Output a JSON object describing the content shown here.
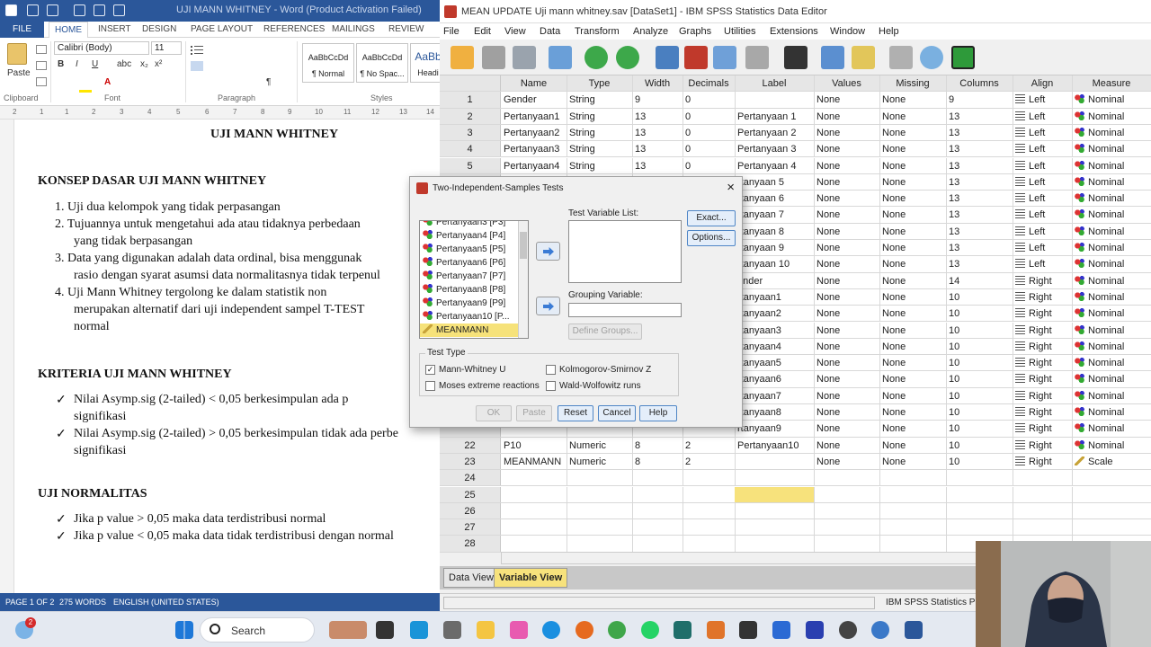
{
  "word": {
    "title": "UJI MANN WHITNEY - Word (Product Activation Failed)",
    "tabs": [
      "FILE",
      "HOME",
      "INSERT",
      "DESIGN",
      "PAGE LAYOUT",
      "REFERENCES",
      "MAILINGS",
      "REVIEW"
    ],
    "font_name": "Calibri (Body)",
    "font_size": "11",
    "paste_label": "Paste",
    "styles": [
      "AaBbCcDd",
      "AaBbCcDd",
      "AaBb"
    ],
    "style_names": [
      "¶ Normal",
      "¶ No Spac...",
      "Headi"
    ],
    "groups": [
      "Clipboard",
      "Font",
      "Paragraph",
      "Styles"
    ],
    "ruler_nums": [
      "1",
      "2",
      "1",
      "2",
      "3",
      "4",
      "5",
      "6",
      "7",
      "8",
      "9",
      "10",
      "11",
      "12",
      "13",
      "14"
    ],
    "doc": {
      "title": "UJI MANN WHITNEY",
      "h1": "KONSEP DASAR UJI MANN WHITNEY",
      "l1": "1.   Uji dua kelompok yang tidak perpasangan",
      "l2a": "2.   Tujuannya untuk mengetahui ada atau tidaknya perbedaan",
      "l2b": "yang tidak berpasangan",
      "l3a": "3.   Data yang digunakan adalah data ordinal, bisa menggunak",
      "l3b": "rasio dengan syarat asumsi data normalitasnya tidak terpenul",
      "l4a": "4.   Uji  Mann  Whitney  tergolong  ke  dalam  statistik  non",
      "l4b": "merupakan alternatif dari uji independent sampel T-TEST",
      "l4c": "normal",
      "h2": "KRITERIA UJI MANN WHITNEY",
      "k1a": "Nilai  Asymp.sig  (2-tailed)  <  0,05     berkesimpulan  ada  p",
      "k1b": "signifikasi",
      "k2a": "Nilai Asymp.sig (2-tailed) > 0,05   berkesimpulan tidak ada perbe",
      "k2b": "signifikasi",
      "h3": "UJI NORMALITAS",
      "n1": "Jika p value > 0,05 maka data terdistribusi normal",
      "n2": "Jika p value < 0,05 maka data tidak terdistribusi dengan normal",
      "check": "✓"
    },
    "status": {
      "page": "PAGE 1 OF 2",
      "words": "275 WORDS",
      "lang": "ENGLISH (UNITED STATES)"
    }
  },
  "spss": {
    "title": "MEAN UPDATE Uji mann whitney.sav [DataSet1] - IBM SPSS Statistics Data Editor",
    "menu": [
      "File",
      "Edit",
      "View",
      "Data",
      "Transform",
      "Analyze",
      "Graphs",
      "Utilities",
      "Extensions",
      "Window",
      "Help"
    ],
    "columns": [
      "Name",
      "Type",
      "Width",
      "Decimals",
      "Label",
      "Values",
      "Missing",
      "Columns",
      "Align",
      "Measure"
    ],
    "rows": [
      [
        "1",
        "Gender",
        "String",
        "9",
        "0",
        "",
        "None",
        "None",
        "9",
        "Left",
        "Nominal"
      ],
      [
        "2",
        "Pertanyaan1",
        "String",
        "13",
        "0",
        "Pertanyaan 1",
        "None",
        "None",
        "13",
        "Left",
        "Nominal"
      ],
      [
        "3",
        "Pertanyaan2",
        "String",
        "13",
        "0",
        "Pertanyaan 2",
        "None",
        "None",
        "13",
        "Left",
        "Nominal"
      ],
      [
        "4",
        "Pertanyaan3",
        "String",
        "13",
        "0",
        "Pertanyaan 3",
        "None",
        "None",
        "13",
        "Left",
        "Nominal"
      ],
      [
        "5",
        "Pertanyaan4",
        "String",
        "13",
        "0",
        "Pertanyaan 4",
        "None",
        "None",
        "13",
        "Left",
        "Nominal"
      ],
      [
        "",
        "",
        "",
        "",
        "",
        "rtanyaan 5",
        "None",
        "None",
        "13",
        "Left",
        "Nominal"
      ],
      [
        "",
        "",
        "",
        "",
        "",
        "rtanyaan 6",
        "None",
        "None",
        "13",
        "Left",
        "Nominal"
      ],
      [
        "",
        "",
        "",
        "",
        "",
        "rtanyaan 7",
        "None",
        "None",
        "13",
        "Left",
        "Nominal"
      ],
      [
        "",
        "",
        "",
        "",
        "",
        "rtanyaan 8",
        "None",
        "None",
        "13",
        "Left",
        "Nominal"
      ],
      [
        "",
        "",
        "",
        "",
        "",
        "rtanyaan 9",
        "None",
        "None",
        "13",
        "Left",
        "Nominal"
      ],
      [
        "",
        "",
        "",
        "",
        "",
        "rtanyaan 10",
        "None",
        "None",
        "13",
        "Left",
        "Nominal"
      ],
      [
        "",
        "",
        "",
        "",
        "",
        "ender",
        "None",
        "None",
        "14",
        "Right",
        "Nominal"
      ],
      [
        "",
        "",
        "",
        "",
        "",
        "rtanyaan1",
        "None",
        "None",
        "10",
        "Right",
        "Nominal"
      ],
      [
        "",
        "",
        "",
        "",
        "",
        "rtanyaan2",
        "None",
        "None",
        "10",
        "Right",
        "Nominal"
      ],
      [
        "",
        "",
        "",
        "",
        "",
        "rtanyaan3",
        "None",
        "None",
        "10",
        "Right",
        "Nominal"
      ],
      [
        "",
        "",
        "",
        "",
        "",
        "rtanyaan4",
        "None",
        "None",
        "10",
        "Right",
        "Nominal"
      ],
      [
        "",
        "",
        "",
        "",
        "",
        "rtanyaan5",
        "None",
        "None",
        "10",
        "Right",
        "Nominal"
      ],
      [
        "",
        "",
        "",
        "",
        "",
        "rtanyaan6",
        "None",
        "None",
        "10",
        "Right",
        "Nominal"
      ],
      [
        "",
        "",
        "",
        "",
        "",
        "rtanyaan7",
        "None",
        "None",
        "10",
        "Right",
        "Nominal"
      ],
      [
        "",
        "",
        "",
        "",
        "",
        "rtanyaan8",
        "None",
        "None",
        "10",
        "Right",
        "Nominal"
      ],
      [
        "",
        "",
        "",
        "",
        "",
        "rtanyaan9",
        "None",
        "None",
        "10",
        "Right",
        "Nominal"
      ],
      [
        "22",
        "P10",
        "Numeric",
        "8",
        "2",
        "Pertanyaan10",
        "None",
        "None",
        "10",
        "Right",
        "Nominal"
      ],
      [
        "23",
        "MEANMANN",
        "Numeric",
        "8",
        "2",
        "",
        "None",
        "None",
        "10",
        "Right",
        "Scale"
      ],
      [
        "24",
        "",
        "",
        "",
        "",
        "",
        "",
        "",
        "",
        "",
        ""
      ],
      [
        "25",
        "",
        "",
        "",
        "",
        "",
        "",
        "",
        "",
        "",
        ""
      ],
      [
        "26",
        "",
        "",
        "",
        "",
        "",
        "",
        "",
        "",
        "",
        ""
      ],
      [
        "27",
        "",
        "",
        "",
        "",
        "",
        "",
        "",
        "",
        "",
        ""
      ],
      [
        "28",
        "",
        "",
        "",
        "",
        "",
        "",
        "",
        "",
        "",
        ""
      ]
    ],
    "tab_data": "Data View",
    "tab_variable": "Variable View",
    "status_text": "IBM SPSS Statistics P"
  },
  "dialog": {
    "title": "Two-Independent-Samples Tests",
    "close": "×",
    "vars": [
      "Pertanyaan3 [P3]",
      "Pertanyaan4 [P4]",
      "Pertanyaan5 [P5]",
      "Pertanyaan6 [P6]",
      "Pertanyaan7 [P7]",
      "Pertanyaan8 [P8]",
      "Pertanyaan9 [P9]",
      "Pertanyaan10 [P...",
      "MEANMANN"
    ],
    "test_list_label": "Test Variable List:",
    "grouping_label": "Grouping Variable:",
    "define_groups": "Define Groups...",
    "exact": "Exact...",
    "options": "Options...",
    "test_type": "Test Type",
    "mann": "Mann-Whitney U",
    "ks": "Kolmogorov-Smirnov Z",
    "moses": "Moses extreme reactions",
    "ww": "Wald-Wolfowitz runs",
    "mann_checked": "✓",
    "ok": "OK",
    "paste": "Paste",
    "reset": "Reset",
    "cancel": "Cancel",
    "help": "Help"
  },
  "taskbar": {
    "search": "Search",
    "badge": "2"
  }
}
